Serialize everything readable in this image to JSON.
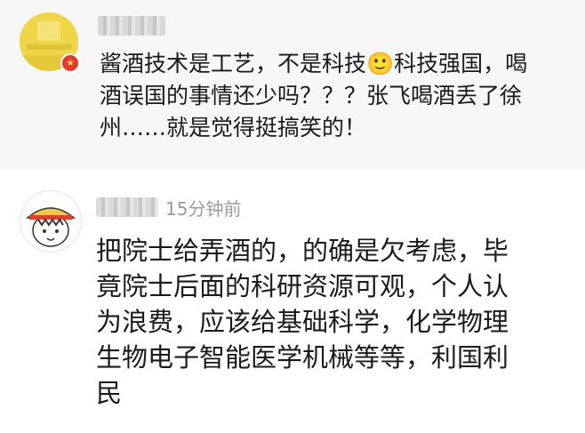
{
  "comments": [
    {
      "badge_icon": "star-icon",
      "text_lines": [
        "酱酒技术是工艺，不是科技🙂科技强国，喝",
        "酒误国的事情还少吗？？？张飞喝酒丢了徐",
        "州……就是觉得挺搞笑的！"
      ]
    },
    {
      "time": "15分钟前",
      "text_lines": [
        "把院士给弄酒的，的确是欠考虑，毕",
        "竟院士后面的科研资源可观，个人认",
        "为浪费，应该给基础科学，化学物理",
        "生物电子智能医学机械等等，利国利",
        "民"
      ]
    }
  ]
}
